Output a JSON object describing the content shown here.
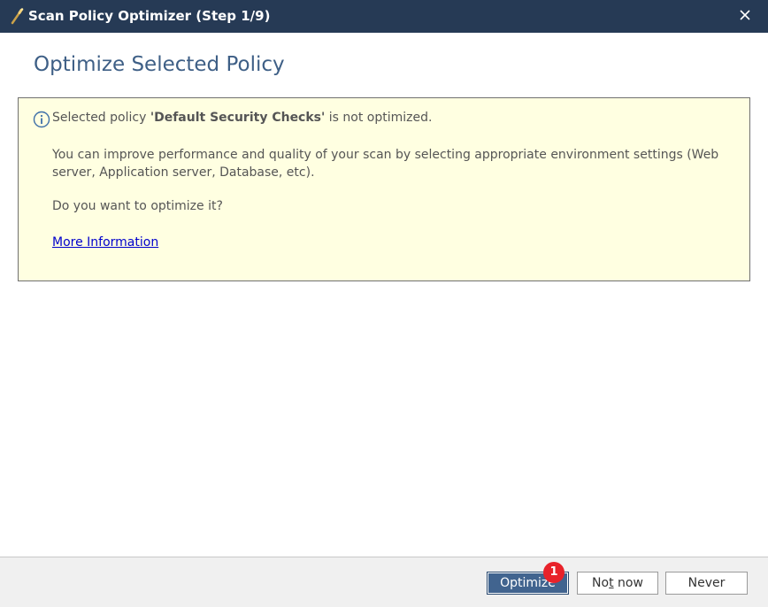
{
  "window": {
    "title": "Scan Policy Optimizer (Step 1/9)",
    "close_symbol": "×"
  },
  "heading": "Optimize Selected Policy",
  "info": {
    "line_prefix": "Selected policy ",
    "policy_name": "'Default Security Checks'",
    "line_suffix": " is not optimized.",
    "paragraph": "You can improve performance and quality of your scan by selecting appropriate environment settings (Web server, Application server, Database, etc).",
    "question": "Do you want to optimize it?",
    "link_text": "More Information"
  },
  "buttons": {
    "optimize": "Optimize",
    "not_now_prefix": "No",
    "not_now_mnemonic": "t",
    "not_now_suffix": " now",
    "never": "Never"
  },
  "badge": "1",
  "colors": {
    "titlebar": "#263a55",
    "heading": "#3e5f86",
    "info_bg": "#ffffe1",
    "link": "#0000cc",
    "primary_button": "#41648f",
    "badge": "#e8222a"
  },
  "icons": [
    "magic-wand-icon",
    "close-icon",
    "info-icon"
  ]
}
